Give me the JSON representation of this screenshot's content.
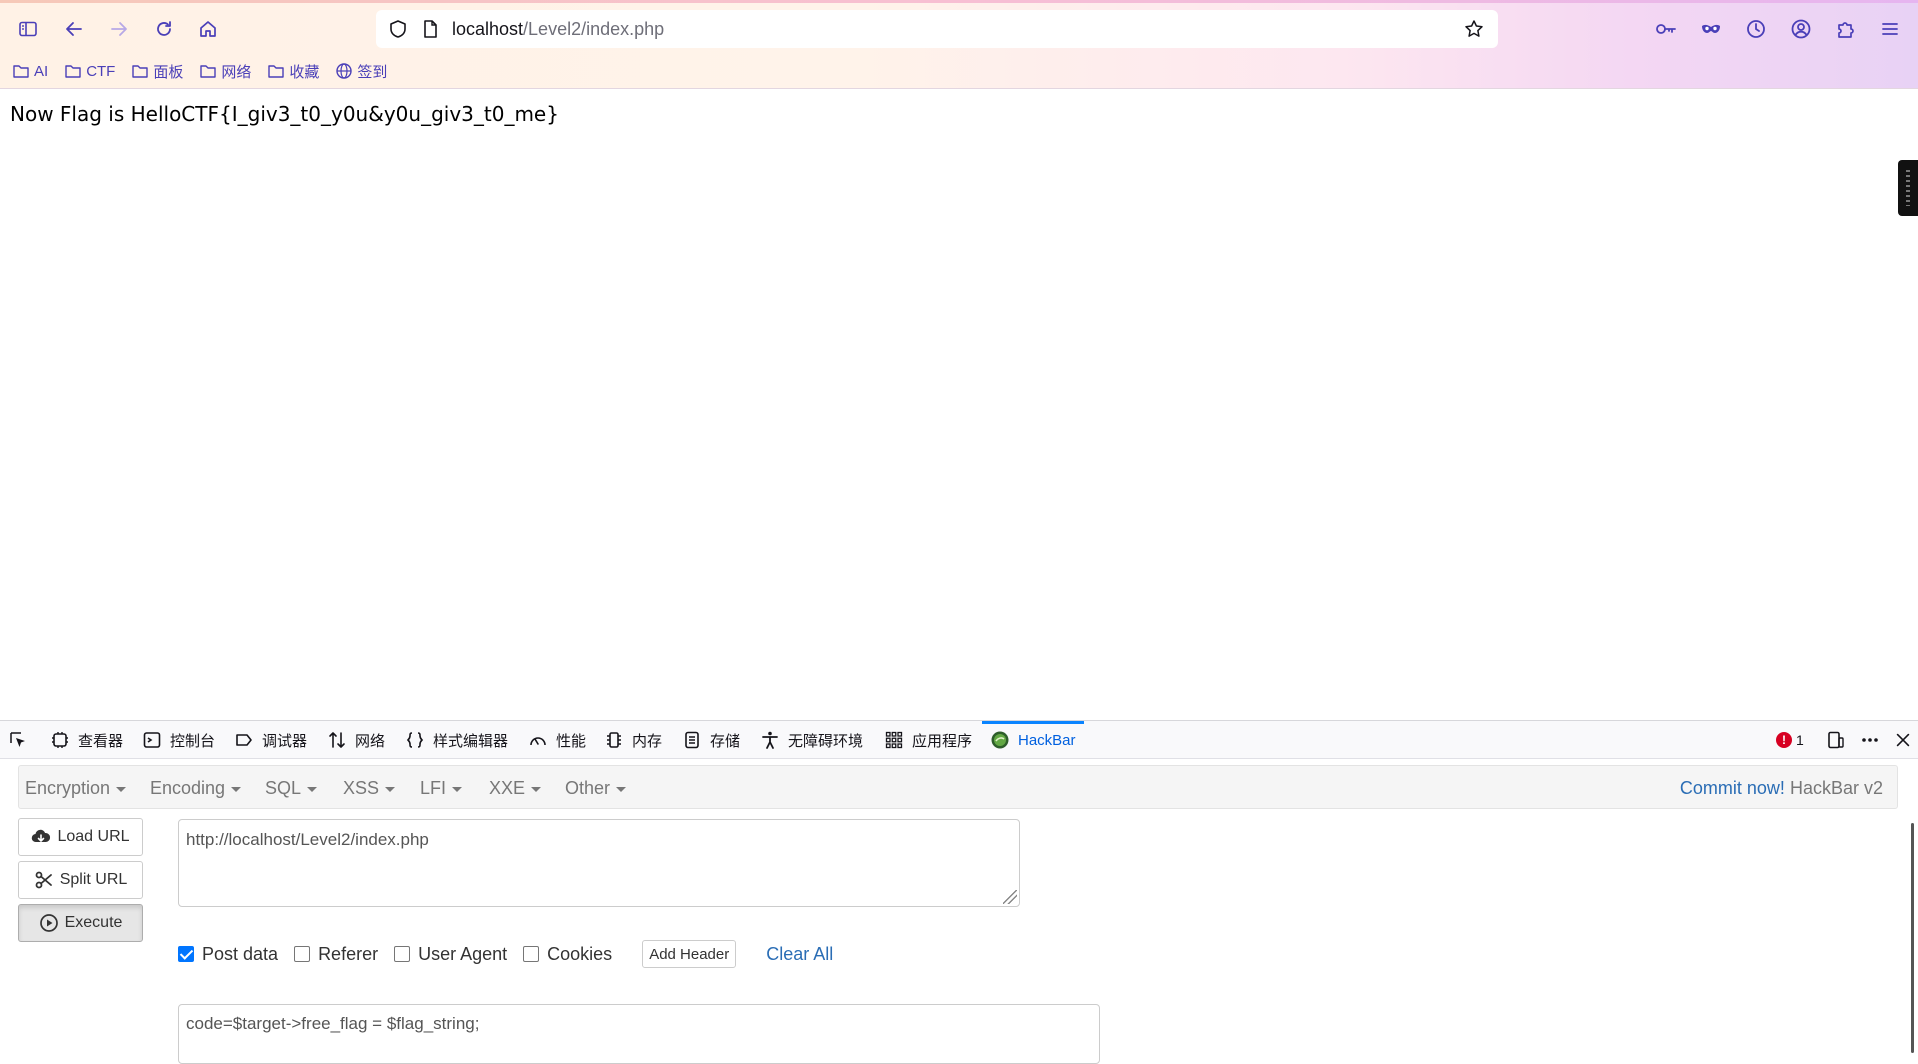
{
  "browser": {
    "url_host": "localhost",
    "url_path": "/Level2/index.php",
    "bookmarks": [
      "AI",
      "CTF",
      "面板",
      "网络",
      "收藏",
      "签到"
    ]
  },
  "page": {
    "text": "Now Flag is HelloCTF{I_giv3_t0_y0u&y0u_giv3_t0_me}"
  },
  "devtools": {
    "tabs": [
      "查看器",
      "控制台",
      "调试器",
      "网络",
      "样式编辑器",
      "性能",
      "内存",
      "存储",
      "无障碍环境",
      "应用程序",
      "HackBar"
    ],
    "error_count": "1"
  },
  "hackbar": {
    "menu": [
      "Encryption",
      "Encoding",
      "SQL",
      "XSS",
      "LFI",
      "XXE",
      "Other"
    ],
    "commit_link": "Commit now!",
    "version": "HackBar v2",
    "buttons": {
      "load": "Load URL",
      "split": "Split URL",
      "execute": "Execute"
    },
    "url_value": "http://localhost/Level2/index.php",
    "options": [
      {
        "label": "Post data",
        "checked": true
      },
      {
        "label": "Referer",
        "checked": false
      },
      {
        "label": "User Agent",
        "checked": false
      },
      {
        "label": "Cookies",
        "checked": false
      }
    ],
    "add_header": "Add Header",
    "clear_all": "Clear All",
    "post_value": "code=$target->free_flag = $flag_string;"
  },
  "colors": {
    "accent": "#0a84ff",
    "link": "#2a6db5",
    "error": "#d70022",
    "bookmark": "#4a3fb8"
  }
}
